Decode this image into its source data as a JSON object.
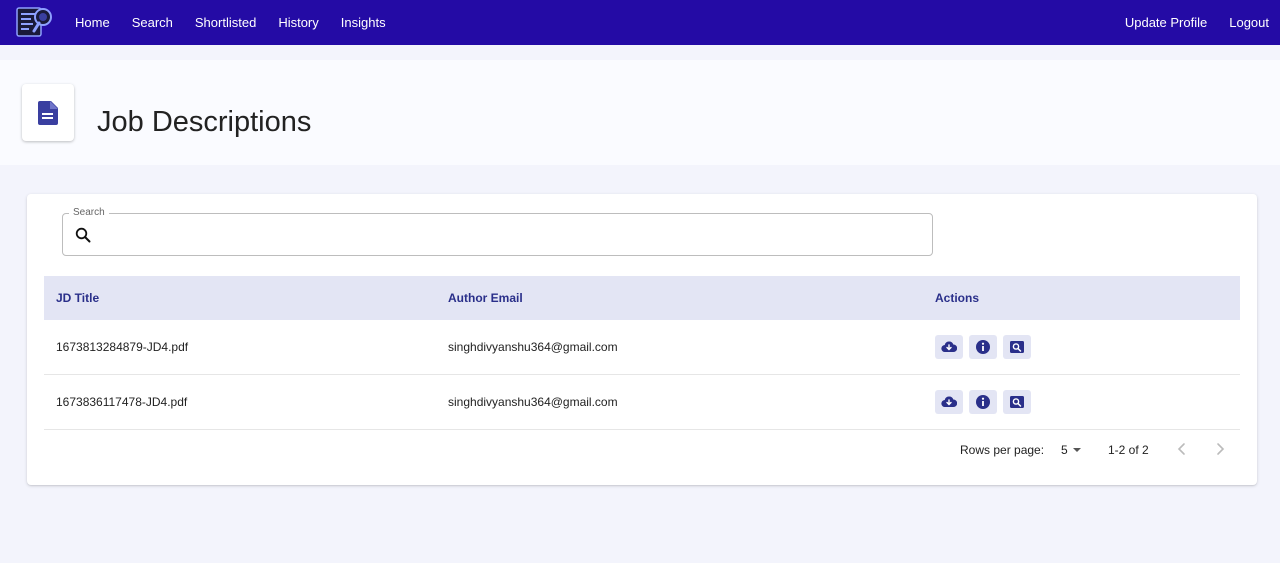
{
  "nav": {
    "links": [
      "Home",
      "Search",
      "Shortlisted",
      "History",
      "Insights"
    ],
    "right_links": [
      "Update Profile",
      "Logout"
    ],
    "logo_icon": "document-magnifier-logo"
  },
  "header": {
    "title": "Job Descriptions",
    "icon": "document-icon"
  },
  "search": {
    "label": "Search",
    "value": "",
    "placeholder": ""
  },
  "table": {
    "columns": [
      "JD Title",
      "Author Email",
      "Actions"
    ],
    "rows": [
      {
        "title": "1673813284879-JD4.pdf",
        "email": "singhdivyanshu364@gmail.com"
      },
      {
        "title": "1673836117478-JD4.pdf",
        "email": "singhdivyanshu364@gmail.com"
      }
    ],
    "actions": [
      "cloud-download-icon",
      "info-icon",
      "search-document-icon"
    ]
  },
  "pagination": {
    "rows_per_page_label": "Rows per page:",
    "rows_per_page_value": "5",
    "range": "1-2 of 2"
  },
  "colors": {
    "navbar": "#240ba5",
    "accent": "#3a3fa0",
    "table_header_bg": "#e3e5f4"
  }
}
